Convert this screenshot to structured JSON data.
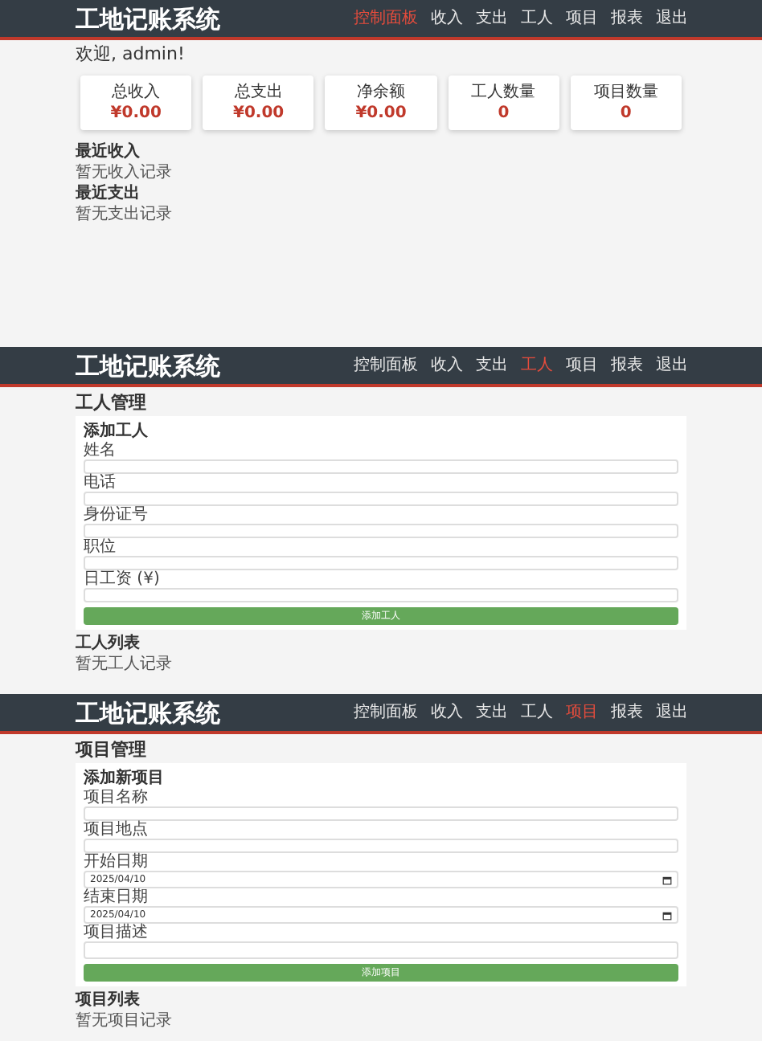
{
  "screens": [
    {
      "kind": "dashboard",
      "header": {
        "title": "工地记账系统",
        "nav": [
          {
            "label": "控制面板",
            "selected": true
          },
          {
            "label": "收入",
            "selected": false
          },
          {
            "label": "支出",
            "selected": false
          },
          {
            "label": "工人",
            "selected": false
          },
          {
            "label": "项目",
            "selected": false
          },
          {
            "label": "报表",
            "selected": false
          },
          {
            "label": "退出",
            "selected": false
          }
        ]
      },
      "welcome": "欢迎, admin!",
      "stats": [
        {
          "label": "总收入",
          "value": "¥0.00"
        },
        {
          "label": "总支出",
          "value": "¥0.00"
        },
        {
          "label": "净余额",
          "value": "¥0.00"
        },
        {
          "label": "工人数量",
          "value": "0"
        },
        {
          "label": "项目数量",
          "value": "0"
        }
      ],
      "sections": [
        {
          "title": "最近收入",
          "empty": "暂无收入记录"
        },
        {
          "title": "最近支出",
          "empty": "暂无支出记录"
        }
      ]
    },
    {
      "kind": "form",
      "header": {
        "title": "工地记账系统",
        "nav": [
          {
            "label": "控制面板",
            "selected": false
          },
          {
            "label": "收入",
            "selected": false
          },
          {
            "label": "支出",
            "selected": false
          },
          {
            "label": "工人",
            "selected": true
          },
          {
            "label": "项目",
            "selected": false
          },
          {
            "label": "报表",
            "selected": false
          },
          {
            "label": "退出",
            "selected": false
          }
        ]
      },
      "page_title": "工人管理",
      "form_title": "添加工人",
      "fields": [
        {
          "kind": "text",
          "label": "姓名"
        },
        {
          "kind": "text",
          "label": "电话"
        },
        {
          "kind": "text",
          "label": "身份证号"
        },
        {
          "kind": "text",
          "label": "职位"
        },
        {
          "kind": "text",
          "label": "日工资 (¥)"
        }
      ],
      "submit": "添加工人",
      "list_title": "工人列表",
      "empty": "暂无工人记录"
    },
    {
      "kind": "form",
      "header": {
        "title": "工地记账系统",
        "nav": [
          {
            "label": "控制面板",
            "selected": false
          },
          {
            "label": "收入",
            "selected": false
          },
          {
            "label": "支出",
            "selected": false
          },
          {
            "label": "工人",
            "selected": false
          },
          {
            "label": "项目",
            "selected": true
          },
          {
            "label": "报表",
            "selected": false
          },
          {
            "label": "退出",
            "selected": false
          }
        ]
      },
      "page_title": "项目管理",
      "form_title": "添加新项目",
      "fields": [
        {
          "kind": "text",
          "label": "项目名称"
        },
        {
          "kind": "text",
          "label": "项目地点"
        },
        {
          "kind": "date",
          "label": "开始日期",
          "value": "2025/04/10"
        },
        {
          "kind": "date",
          "label": "结束日期",
          "value": "2025/04/10"
        },
        {
          "kind": "textarea",
          "label": "项目描述"
        }
      ],
      "submit": "添加项目",
      "list_title": "项目列表",
      "empty": "暂无项目记录"
    }
  ]
}
